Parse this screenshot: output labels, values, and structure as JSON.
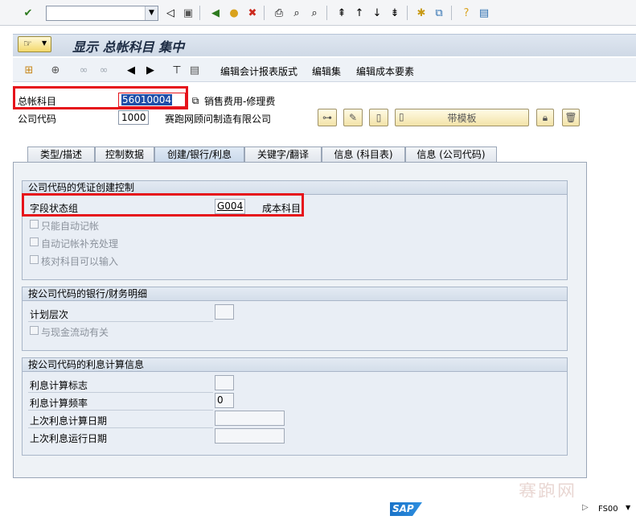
{
  "systoolbar": {
    "command_value": "",
    "icons": [
      "enter-icon",
      "save-icon",
      "back-icon",
      "exit-icon",
      "cancel-icon",
      "print-icon",
      "find-icon",
      "find-next-icon",
      "first-page-icon",
      "prev-page-icon",
      "next-page-icon",
      "last-page-icon",
      "new-session-icon",
      "shortcut-icon",
      "help-icon",
      "layout-icon"
    ]
  },
  "title": "显示 总帐科目 集中",
  "apptoolbar": {
    "edit_report_layout": "编辑会计报表版式",
    "edit_set": "编辑集",
    "edit_cost_element": "编辑成本要素"
  },
  "header": {
    "gl_account_label": "总帐科目",
    "gl_account_value": "56010004",
    "gl_account_desc": "销售费用-修理费",
    "company_code_label": "公司代码",
    "company_code_value": "1000",
    "company_code_desc": "赛跑网顾问制造有限公司",
    "with_template_label": "带模板"
  },
  "tabs": [
    {
      "label": "类型/描述"
    },
    {
      "label": "控制数据"
    },
    {
      "label": "创建/银行/利息"
    },
    {
      "label": "关键字/翻译"
    },
    {
      "label": "信息 (科目表)"
    },
    {
      "label": "信息 (公司代码)"
    }
  ],
  "groups": {
    "doc_control": {
      "title": "公司代码的凭证创建控制",
      "field_status_label": "字段状态组",
      "field_status_value": "G004",
      "field_status_desc": "成本科目",
      "post_auto_only": "只能自动记帐",
      "supplement_auto": "自动记帐补充处理",
      "recon_acct_input": "核对科目可以输入"
    },
    "bank": {
      "title": "按公司代码的银行/财务明细",
      "planning_level_label": "计划层次",
      "planning_level_value": "",
      "cash_flow_relevant": "与现金流动有关"
    },
    "interest": {
      "title": "按公司代码的利息计算信息",
      "interest_indicator_label": "利息计算标志",
      "interest_indicator_value": "",
      "interest_freq_label": "利息计算频率",
      "interest_freq_value": "0",
      "last_calc_date_label": "上次利息计算日期",
      "last_calc_date_value": "",
      "last_run_date_label": "上次利息运行日期",
      "last_run_date_value": ""
    }
  },
  "status": {
    "sap_logo": "SAP",
    "tcode": "FS00"
  },
  "watermark": "赛跑网",
  "colors": {
    "highlight": "#e6131b",
    "selection": "#1f4ea8"
  }
}
